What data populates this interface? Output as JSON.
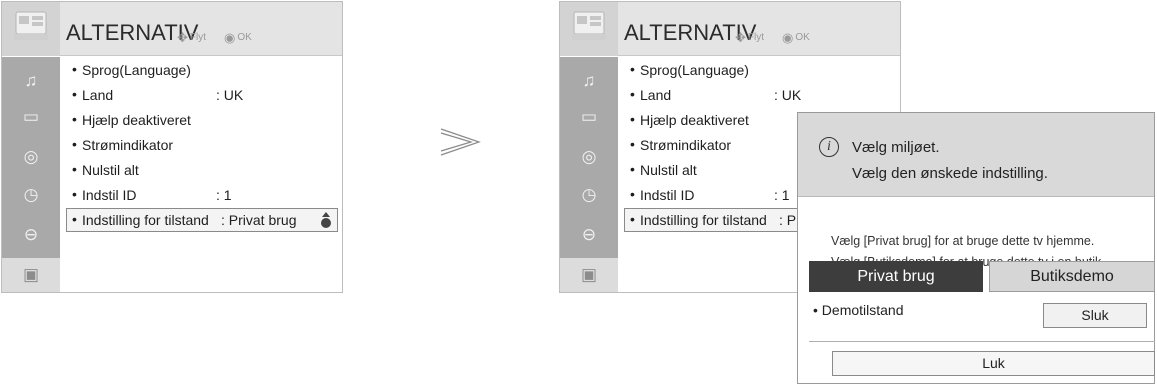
{
  "left_panel": {
    "title": "ALTERNATIV",
    "hint_move": "Flyt",
    "hint_ok": "OK",
    "items": [
      {
        "label": "Sprog(Language)",
        "value": ""
      },
      {
        "label": "Land",
        "value": ": UK"
      },
      {
        "label": "Hjælp deaktiveret",
        "value": ""
      },
      {
        "label": "Strømindikator",
        "value": ""
      },
      {
        "label": "Nulstil alt",
        "value": ""
      },
      {
        "label": "Indstil ID",
        "value": ": 1"
      },
      {
        "label": "Indstilling for tilstand",
        "value": ": Privat brug"
      }
    ]
  },
  "right_panel": {
    "title": "ALTERNATIV",
    "hint_move": "Flyt",
    "hint_ok": "OK",
    "items": [
      {
        "label": "Sprog(Language)",
        "value": ""
      },
      {
        "label": "Land",
        "value": ": UK"
      },
      {
        "label": "Hjælp deaktiveret",
        "value": ""
      },
      {
        "label": "Strømindikator",
        "value": ""
      },
      {
        "label": "Nulstil alt",
        "value": ""
      },
      {
        "label": "Indstil ID",
        "value": ": 1"
      },
      {
        "label": "Indstilling for tilstand",
        "value": ": Priva"
      }
    ]
  },
  "side_icons": [
    "audio-icon",
    "picture-icon",
    "speaker-icon",
    "clock-icon",
    "lock-icon",
    "option-icon"
  ],
  "bullet": "•",
  "dialog": {
    "info_glyph": "i",
    "message_1": "Vælg miljøet.",
    "message_2": "Vælg den ønskede indstilling.",
    "description_1": "Vælg [Privat brug] for at bruge dette tv hjemme.",
    "description_2": "Vælg [Butiksdemo] for at bruge dette tv i en butik.",
    "choices": [
      "Privat brug",
      "Butiksdemo"
    ],
    "demo_label": "Demotilstand",
    "demo_value": "Sluk",
    "close_label": "Luk"
  },
  "colors": {
    "panel_header": "#e4e4e4",
    "icon_column": "#a9a9a9",
    "selected_button": "#3d3d3d",
    "dialog_header": "#d9d9d9"
  }
}
